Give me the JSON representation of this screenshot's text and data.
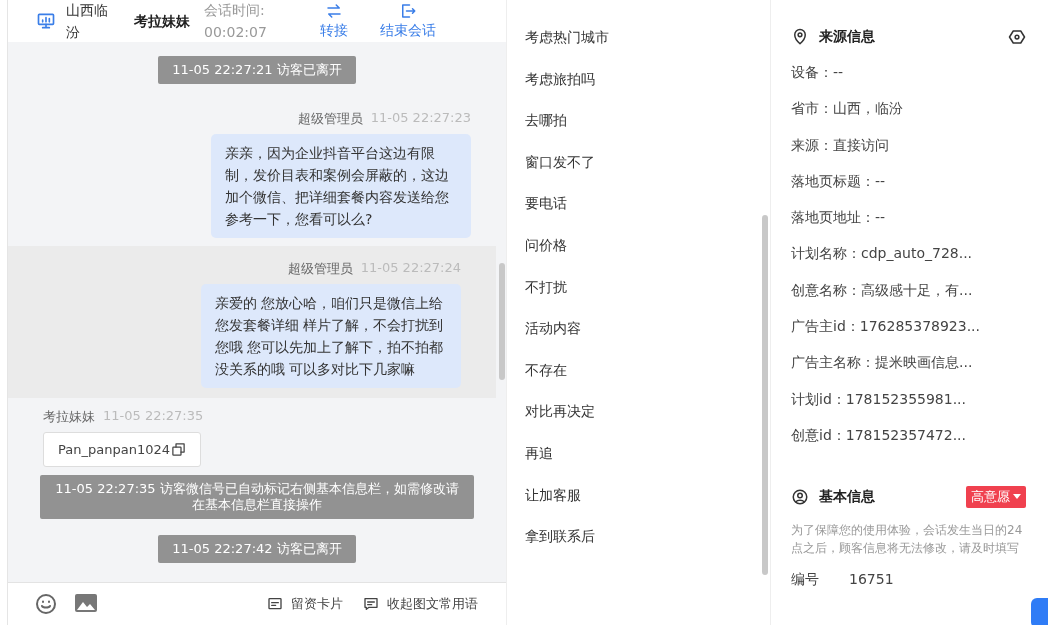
{
  "header": {
    "location": "山西临汾",
    "name": "考拉妹妹",
    "session_label": "会话时间:",
    "session_time": "00:02:07",
    "actions": [
      {
        "kind": "transfer",
        "label": "转接"
      },
      {
        "kind": "end",
        "label": "结束会话"
      }
    ]
  },
  "messages": [
    {
      "kind": "system",
      "text": "11-05 22:27:21 访客已离开"
    },
    {
      "kind": "agent",
      "sender": "超级管理员",
      "time": "11-05 22:27:23",
      "text": "亲亲，因为企业抖音平台这边有限制，发价目表和案例会屏蔽的，这边加个微信、把详细套餐内容发送给您参考一下，您看可以么?",
      "highlighted": false
    },
    {
      "kind": "agent",
      "sender": "超级管理员",
      "time": "11-05 22:27:24",
      "text": "亲爱的 您放心哈，咱们只是微信上给您发套餐详细 样片了解，不会打扰到您哦 您可以先加上了解下，拍不拍都没关系的哦 可以多对比下几家嘛",
      "highlighted": true
    },
    {
      "kind": "visitor",
      "sender": "考拉妹妹",
      "time": "11-05 22:27:35",
      "text": "Pan_panpan1024"
    },
    {
      "kind": "system",
      "text": "11-05 22:27:35 访客微信号已自动标记右侧基本信息栏，如需修改请在基本信息栏直接操作"
    },
    {
      "kind": "system",
      "text": "11-05 22:27:42 访客已离开"
    }
  ],
  "toolbar": {
    "tools": [
      {
        "kind": "card",
        "label": "留资卡片"
      },
      {
        "kind": "collapse",
        "label": "收起图文常用语"
      }
    ]
  },
  "phrases": [
    "考虑热门城市",
    "考虑旅拍吗",
    "去哪拍",
    "窗口发不了",
    "要电话",
    "问价格",
    "不打扰",
    "活动内容",
    "不存在",
    "对比再决定",
    "再追",
    "让加客服",
    "拿到联系后"
  ],
  "source_info": {
    "title": "来源信息",
    "fields": [
      "设备：--",
      "省市：山西，临汾",
      "来源：直接访问",
      "落地页标题：--",
      "落地页地址：--",
      "计划名称：cdp_auto_728...",
      "创意名称：高级感十足，有...",
      "广告主id：176285378923...",
      "广告主名称：提米映画信息...",
      "计划id：178152355981...",
      "创意id：178152357472..."
    ]
  },
  "basic_info": {
    "title": "基本信息",
    "intent": "高意愿",
    "note": "为了保障您的使用体验，会话发生当日的24点之后，顾客信息将无法修改，请及时填写",
    "fields": [
      {
        "label": "编号",
        "value": "16751"
      }
    ]
  }
}
